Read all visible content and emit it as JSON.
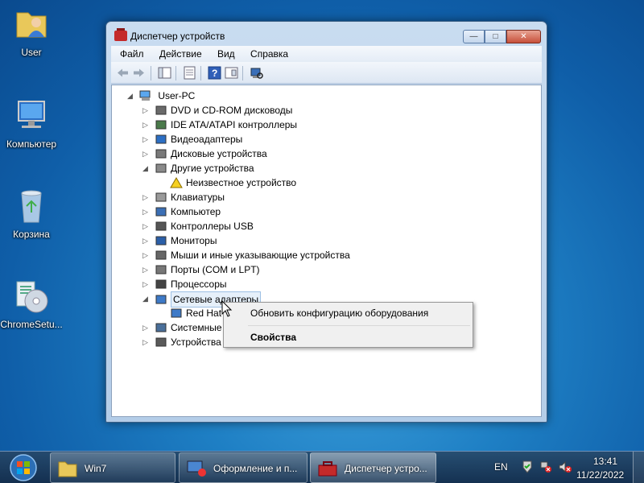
{
  "desktop": {
    "icons": [
      {
        "label": "User",
        "icon": "user-folder-icon"
      },
      {
        "label": "Компьютер",
        "icon": "computer-icon"
      },
      {
        "label": "Корзина",
        "icon": "recycle-bin-icon"
      },
      {
        "label": "ChromeSetu...",
        "icon": "setup-disc-icon"
      }
    ]
  },
  "window": {
    "title": "Диспетчер устройств",
    "controls": {
      "minimize": "—",
      "maximize": "□",
      "close": "✕"
    },
    "menu": [
      "Файл",
      "Действие",
      "Вид",
      "Справка"
    ]
  },
  "tree": {
    "root": "User-PC",
    "items": [
      {
        "label": "DVD и CD-ROM дисководы",
        "expander": "▷"
      },
      {
        "label": "IDE ATA/ATAPI контроллеры",
        "expander": "▷"
      },
      {
        "label": "Видеоадаптеры",
        "expander": "▷"
      },
      {
        "label": "Дисковые устройства",
        "expander": "▷"
      },
      {
        "label": "Другие устройства",
        "expander": "◢"
      },
      {
        "label": "Неизвестное устройство",
        "expander": ""
      },
      {
        "label": "Клавиатуры",
        "expander": "▷"
      },
      {
        "label": "Компьютер",
        "expander": "▷"
      },
      {
        "label": "Контроллеры USB",
        "expander": "▷"
      },
      {
        "label": "Мониторы",
        "expander": "▷"
      },
      {
        "label": "Мыши и иные указывающие устройства",
        "expander": "▷"
      },
      {
        "label": "Порты (COM и LPT)",
        "expander": "▷"
      },
      {
        "label": "Процессоры",
        "expander": "▷"
      },
      {
        "label": "Сетевые адаптеры",
        "expander": "◢"
      },
      {
        "label": "Red Hat V",
        "expander": ""
      },
      {
        "label": "Системные у",
        "expander": "▷"
      },
      {
        "label": "Устройства Н",
        "expander": "▷"
      }
    ]
  },
  "context_menu": {
    "items": [
      "Обновить конфигурацию оборудования",
      "Свойства"
    ]
  },
  "taskbar": {
    "tasks": [
      {
        "label": "Win7"
      },
      {
        "label": "Оформление и п..."
      },
      {
        "label": "Диспетчер устро..."
      }
    ],
    "language": "EN",
    "time": "13:41",
    "date": "11/22/2022"
  }
}
